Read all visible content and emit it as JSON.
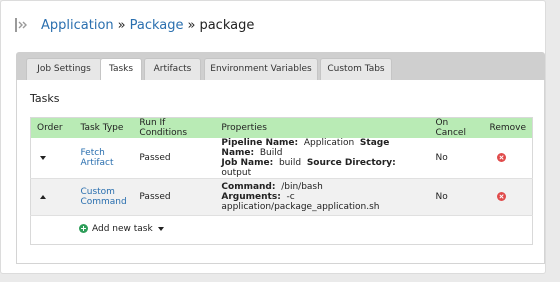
{
  "breadcrumb": {
    "pipeline": "Application",
    "stage": "Package",
    "separator": "»",
    "job": "package"
  },
  "tabs": [
    {
      "label": "Job Settings",
      "active": false
    },
    {
      "label": "Tasks",
      "active": true
    },
    {
      "label": "Artifacts",
      "active": false
    },
    {
      "label": "Environment Variables",
      "active": false
    },
    {
      "label": "Custom Tabs",
      "active": false
    }
  ],
  "section": {
    "title": "Tasks"
  },
  "table": {
    "headers": {
      "order": "Order",
      "task_type": "Task Type",
      "run_if": "Run If Conditions",
      "properties": "Properties",
      "on_cancel": "On Cancel",
      "remove": "Remove"
    },
    "rows": [
      {
        "task_type": "Fetch Artifact",
        "task_type_line1": "Fetch",
        "task_type_line2": "Artifact",
        "run_if": "Passed",
        "props": {
          "pipeline_label": "Pipeline Name:",
          "pipeline_value": "Application",
          "stage_label": "Stage Name:",
          "stage_value": "Build",
          "job_label": "Job Name:",
          "job_value": "build",
          "source_label": "Source Directory:",
          "source_value": "output"
        },
        "on_cancel": "No"
      },
      {
        "task_type": "Custom Command",
        "task_type_line1": "Custom",
        "task_type_line2": "Command",
        "run_if": "Passed",
        "props": {
          "command_label": "Command:",
          "command_value": "/bin/bash",
          "arguments_label": "Arguments:",
          "arguments_value": "-c",
          "arguments_line2": "application/package_application.sh"
        },
        "on_cancel": "No"
      }
    ],
    "add_label": "Add new task"
  },
  "colors": {
    "link": "#2a6faf",
    "header_row": "#b9ebb5",
    "remove": "#e04b4b",
    "add": "#2f9e5a"
  }
}
